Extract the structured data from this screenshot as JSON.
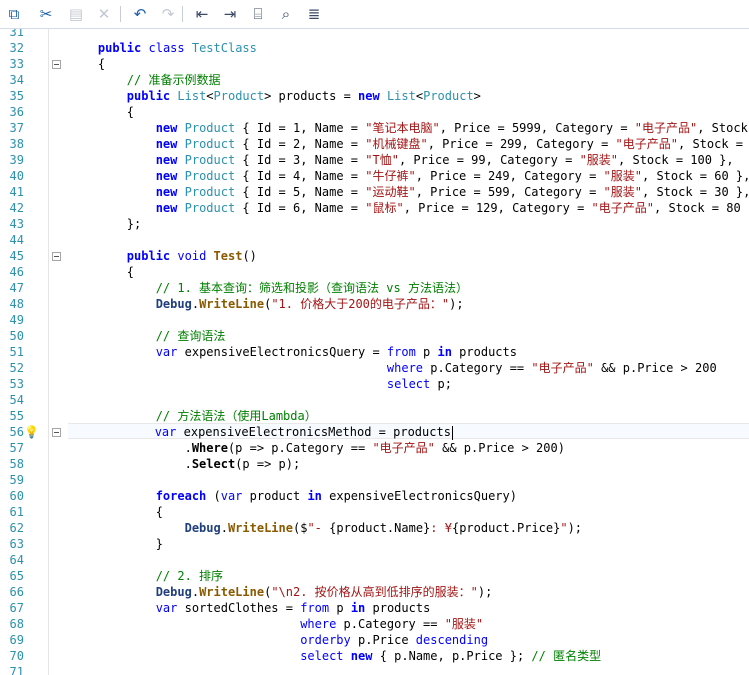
{
  "toolbar": {
    "buttons": [
      {
        "name": "copy-button",
        "icon": "copy-icon",
        "glyph": "⧉",
        "enabled": true
      },
      {
        "name": "cut-button",
        "icon": "scissors-icon",
        "glyph": "✂",
        "enabled": true
      },
      {
        "name": "paste-button",
        "icon": "paste-icon",
        "glyph": "▤",
        "enabled": false
      },
      {
        "name": "delete-button",
        "icon": "close-icon",
        "glyph": "✕",
        "enabled": false
      },
      {
        "name": "undo-button",
        "icon": "undo-icon",
        "glyph": "↶",
        "enabled": true
      },
      {
        "name": "redo-button",
        "icon": "redo-icon",
        "glyph": "↷",
        "enabled": false
      },
      {
        "name": "outdent-button",
        "icon": "outdent-icon",
        "glyph": "⇤",
        "enabled": true
      },
      {
        "name": "indent-button",
        "icon": "indent-icon",
        "glyph": "⇥",
        "enabled": true
      },
      {
        "name": "insert-snippet-button",
        "icon": "snippet-icon",
        "glyph": "⌸",
        "enabled": true
      },
      {
        "name": "find-button",
        "icon": "find-icon",
        "glyph": "⌕",
        "enabled": true
      },
      {
        "name": "format-button",
        "icon": "align-icon",
        "glyph": "≣",
        "enabled": true
      }
    ]
  },
  "editor": {
    "current_line": 56,
    "lightbulb_line": 56,
    "fold_lines": [
      33,
      45,
      56
    ],
    "lines": [
      {
        "n": "31",
        "segments": []
      },
      {
        "n": "32",
        "segments": [
          {
            "t": "    "
          },
          {
            "t": "public",
            "c": "kw"
          },
          {
            "t": " "
          },
          {
            "t": "class",
            "c": "kn"
          },
          {
            "t": " "
          },
          {
            "t": "TestClass",
            "c": "ty"
          }
        ]
      },
      {
        "n": "33",
        "segments": [
          {
            "t": "    {"
          }
        ]
      },
      {
        "n": "34",
        "segments": [
          {
            "t": "        "
          },
          {
            "t": "// 准备示例数据",
            "c": "cm"
          }
        ]
      },
      {
        "n": "35",
        "segments": [
          {
            "t": "        "
          },
          {
            "t": "public",
            "c": "kw"
          },
          {
            "t": " "
          },
          {
            "t": "List",
            "c": "ty"
          },
          {
            "t": "<"
          },
          {
            "t": "Product",
            "c": "ty"
          },
          {
            "t": "> products = "
          },
          {
            "t": "new",
            "c": "kw"
          },
          {
            "t": " "
          },
          {
            "t": "List",
            "c": "ty"
          },
          {
            "t": "<"
          },
          {
            "t": "Product",
            "c": "ty"
          },
          {
            "t": ">"
          }
        ]
      },
      {
        "n": "36",
        "segments": [
          {
            "t": "        {"
          }
        ]
      },
      {
        "n": "37",
        "segments": [
          {
            "t": "            "
          },
          {
            "t": "new",
            "c": "kw"
          },
          {
            "t": " "
          },
          {
            "t": "Product",
            "c": "ty"
          },
          {
            "t": " { Id = 1, Name = "
          },
          {
            "t": "\"笔记本电脑\"",
            "c": "str"
          },
          {
            "t": ", Price = 5999, Category = "
          },
          {
            "t": "\"电子产品\"",
            "c": "str"
          },
          {
            "t": ", Stock"
          }
        ]
      },
      {
        "n": "38",
        "segments": [
          {
            "t": "            "
          },
          {
            "t": "new",
            "c": "kw"
          },
          {
            "t": " "
          },
          {
            "t": "Product",
            "c": "ty"
          },
          {
            "t": " { Id = 2, Name = "
          },
          {
            "t": "\"机械键盘\"",
            "c": "str"
          },
          {
            "t": ", Price = 299, Category = "
          },
          {
            "t": "\"电子产品\"",
            "c": "str"
          },
          {
            "t": ", Stock ="
          }
        ]
      },
      {
        "n": "39",
        "segments": [
          {
            "t": "            "
          },
          {
            "t": "new",
            "c": "kw"
          },
          {
            "t": " "
          },
          {
            "t": "Product",
            "c": "ty"
          },
          {
            "t": " { Id = 3, Name = "
          },
          {
            "t": "\"T恤\"",
            "c": "str"
          },
          {
            "t": ", Price = 99, Category = "
          },
          {
            "t": "\"服装\"",
            "c": "str"
          },
          {
            "t": ", Stock = 100 },"
          }
        ]
      },
      {
        "n": "40",
        "segments": [
          {
            "t": "            "
          },
          {
            "t": "new",
            "c": "kw"
          },
          {
            "t": " "
          },
          {
            "t": "Product",
            "c": "ty"
          },
          {
            "t": " { Id = 4, Name = "
          },
          {
            "t": "\"牛仔裤\"",
            "c": "str"
          },
          {
            "t": ", Price = 249, Category = "
          },
          {
            "t": "\"服装\"",
            "c": "str"
          },
          {
            "t": ", Stock = 60 },"
          }
        ]
      },
      {
        "n": "41",
        "segments": [
          {
            "t": "            "
          },
          {
            "t": "new",
            "c": "kw"
          },
          {
            "t": " "
          },
          {
            "t": "Product",
            "c": "ty"
          },
          {
            "t": " { Id = 5, Name = "
          },
          {
            "t": "\"运动鞋\"",
            "c": "str"
          },
          {
            "t": ", Price = 599, Category = "
          },
          {
            "t": "\"服装\"",
            "c": "str"
          },
          {
            "t": ", Stock = 30 },"
          }
        ]
      },
      {
        "n": "42",
        "segments": [
          {
            "t": "            "
          },
          {
            "t": "new",
            "c": "kw"
          },
          {
            "t": " "
          },
          {
            "t": "Product",
            "c": "ty"
          },
          {
            "t": " { Id = 6, Name = "
          },
          {
            "t": "\"鼠标\"",
            "c": "str"
          },
          {
            "t": ", Price = 129, Category = "
          },
          {
            "t": "\"电子产品\"",
            "c": "str"
          },
          {
            "t": ", Stock = 80 }"
          }
        ]
      },
      {
        "n": "43",
        "segments": [
          {
            "t": "        };"
          }
        ]
      },
      {
        "n": "44",
        "segments": []
      },
      {
        "n": "45",
        "segments": [
          {
            "t": "        "
          },
          {
            "t": "public",
            "c": "kw"
          },
          {
            "t": " "
          },
          {
            "t": "void",
            "c": "kn"
          },
          {
            "t": " "
          },
          {
            "t": "Test",
            "c": "mt"
          },
          {
            "t": "()"
          }
        ]
      },
      {
        "n": "46",
        "segments": [
          {
            "t": "        {"
          }
        ]
      },
      {
        "n": "47",
        "segments": [
          {
            "t": "            "
          },
          {
            "t": "// 1. 基本查询：筛选和投影（查询语法 vs 方法语法）",
            "c": "cm"
          }
        ]
      },
      {
        "n": "48",
        "segments": [
          {
            "t": "            "
          },
          {
            "t": "Debug",
            "c": "ty b"
          },
          {
            "t": "."
          },
          {
            "t": "WriteLine",
            "c": "mt"
          },
          {
            "t": "("
          },
          {
            "t": "\"1. 价格大于200的电子产品：\"",
            "c": "str"
          },
          {
            "t": ");"
          }
        ]
      },
      {
        "n": "49",
        "segments": []
      },
      {
        "n": "50",
        "segments": [
          {
            "t": "            "
          },
          {
            "t": "// 查询语法",
            "c": "cm"
          }
        ]
      },
      {
        "n": "51",
        "segments": [
          {
            "t": "            "
          },
          {
            "t": "var",
            "c": "kn"
          },
          {
            "t": " expensiveElectronicsQuery = "
          },
          {
            "t": "from",
            "c": "kn"
          },
          {
            "t": " p "
          },
          {
            "t": "in",
            "c": "kw"
          },
          {
            "t": " products"
          }
        ]
      },
      {
        "n": "52",
        "segments": [
          {
            "t": "                                            "
          },
          {
            "t": "where",
            "c": "kn"
          },
          {
            "t": " p.Category == "
          },
          {
            "t": "\"电子产品\"",
            "c": "str"
          },
          {
            "t": " && p.Price > 200"
          }
        ]
      },
      {
        "n": "53",
        "segments": [
          {
            "t": "                                            "
          },
          {
            "t": "select",
            "c": "kn"
          },
          {
            "t": " p;"
          }
        ]
      },
      {
        "n": "54",
        "segments": []
      },
      {
        "n": "55",
        "segments": [
          {
            "t": "            "
          },
          {
            "t": "// 方法语法（使用Lambda）",
            "c": "cm"
          }
        ]
      },
      {
        "n": "56",
        "segments": [
          {
            "t": "            "
          },
          {
            "t": "var",
            "c": "kn"
          },
          {
            "t": " expensiveElectronicsMethod = products"
          }
        ]
      },
      {
        "n": "57",
        "segments": [
          {
            "t": "                ."
          },
          {
            "t": "Where",
            "c": "mb"
          },
          {
            "t": "(p => p.Category == "
          },
          {
            "t": "\"电子产品\"",
            "c": "str"
          },
          {
            "t": " && p.Price > 200)"
          }
        ]
      },
      {
        "n": "58",
        "segments": [
          {
            "t": "                ."
          },
          {
            "t": "Select",
            "c": "mb"
          },
          {
            "t": "(p => p);"
          }
        ]
      },
      {
        "n": "59",
        "segments": []
      },
      {
        "n": "60",
        "segments": [
          {
            "t": "            "
          },
          {
            "t": "foreach",
            "c": "kw"
          },
          {
            "t": " ("
          },
          {
            "t": "var",
            "c": "kn"
          },
          {
            "t": " product "
          },
          {
            "t": "in",
            "c": "kw"
          },
          {
            "t": " expensiveElectronicsQuery)"
          }
        ]
      },
      {
        "n": "61",
        "segments": [
          {
            "t": "            {"
          }
        ]
      },
      {
        "n": "62",
        "segments": [
          {
            "t": "                "
          },
          {
            "t": "Debug",
            "c": "ty b"
          },
          {
            "t": "."
          },
          {
            "t": "WriteLine",
            "c": "mt"
          },
          {
            "t": "($"
          },
          {
            "t": "\"- ",
            "c": "str"
          },
          {
            "t": "{product.Name}"
          },
          {
            "t": ": ¥",
            "c": "str"
          },
          {
            "t": "{product.Price}"
          },
          {
            "t": "\"",
            "c": "str"
          },
          {
            "t": ");"
          }
        ]
      },
      {
        "n": "63",
        "segments": [
          {
            "t": "            }"
          }
        ]
      },
      {
        "n": "64",
        "segments": []
      },
      {
        "n": "65",
        "segments": [
          {
            "t": "            "
          },
          {
            "t": "// 2. 排序",
            "c": "cm"
          }
        ]
      },
      {
        "n": "66",
        "segments": [
          {
            "t": "            "
          },
          {
            "t": "Debug",
            "c": "ty b"
          },
          {
            "t": "."
          },
          {
            "t": "WriteLine",
            "c": "mt"
          },
          {
            "t": "("
          },
          {
            "t": "\"\\n2. 按价格从高到低排序的服装：\"",
            "c": "str"
          },
          {
            "t": ");"
          }
        ]
      },
      {
        "n": "67",
        "segments": [
          {
            "t": "            "
          },
          {
            "t": "var",
            "c": "kn"
          },
          {
            "t": " sortedClothes = "
          },
          {
            "t": "from",
            "c": "kn"
          },
          {
            "t": " p "
          },
          {
            "t": "in",
            "c": "kw"
          },
          {
            "t": " products"
          }
        ]
      },
      {
        "n": "68",
        "segments": [
          {
            "t": "                                "
          },
          {
            "t": "where",
            "c": "kn"
          },
          {
            "t": " p.Category == "
          },
          {
            "t": "\"服装\"",
            "c": "str"
          }
        ]
      },
      {
        "n": "69",
        "segments": [
          {
            "t": "                                "
          },
          {
            "t": "orderby",
            "c": "kn"
          },
          {
            "t": " p.Price "
          },
          {
            "t": "descending",
            "c": "kn"
          }
        ]
      },
      {
        "n": "70",
        "segments": [
          {
            "t": "                                "
          },
          {
            "t": "select",
            "c": "kn"
          },
          {
            "t": " "
          },
          {
            "t": "new",
            "c": "kw"
          },
          {
            "t": " { p.Name, p.Price }; "
          },
          {
            "t": "// 匿名类型",
            "c": "cm"
          }
        ]
      },
      {
        "n": "71",
        "segments": []
      }
    ]
  }
}
